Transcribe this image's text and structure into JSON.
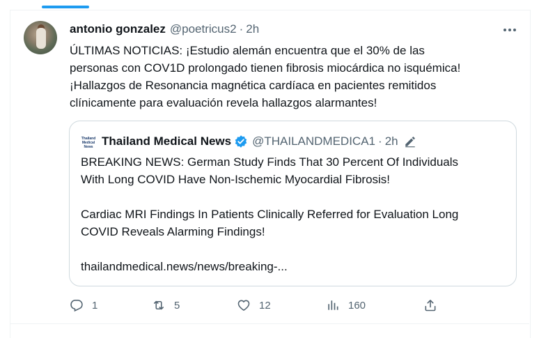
{
  "tweet": {
    "author_name": "antonio gonzalez",
    "handle": "@poetricus2",
    "separator": "·",
    "time": "2h",
    "text_lines": [
      "ÚLTIMAS NOTICIAS: ¡Estudio alemán encuentra que el 30% de las",
      "personas con COV1D prolongado tienen fibrosis miocárdica no isquémica!",
      "¡Hallazgos de Resonancia magnética cardíaca en pacientes remitidos",
      "clínicamente para evaluación revela hallazgos alarmantes!"
    ]
  },
  "quote": {
    "name": "Thailand Medical News",
    "handle": "@THAILANDMEDICA1",
    "separator": "·",
    "time": "2h",
    "logo_text": "Thailand Medical News",
    "body_lines_1": [
      "BREAKING NEWS: German Study Finds That 30 Percent Of Individuals",
      "With Long COVID Have Non-Ischemic Myocardial Fibrosis!"
    ],
    "body_lines_2": [
      "Cardiac MRI Findings In Patients Clinically Referred for Evaluation Long",
      "COVID Reveals Alarming Findings!"
    ],
    "link": "thailandmedical.news/news/breaking-..."
  },
  "actions": {
    "reply_count": "1",
    "retweet_count": "5",
    "like_count": "12",
    "views_count": "160"
  },
  "icons": {
    "more": "more-icon",
    "verified": "verified-badge-icon",
    "edit": "edit-pencil-icon",
    "reply": "reply-icon",
    "retweet": "retweet-icon",
    "like": "heart-icon",
    "views": "views-chart-icon",
    "share": "share-icon"
  },
  "colors": {
    "accent": "#1d9bf0",
    "secondary_text": "#536471",
    "border": "#cfd9de"
  }
}
